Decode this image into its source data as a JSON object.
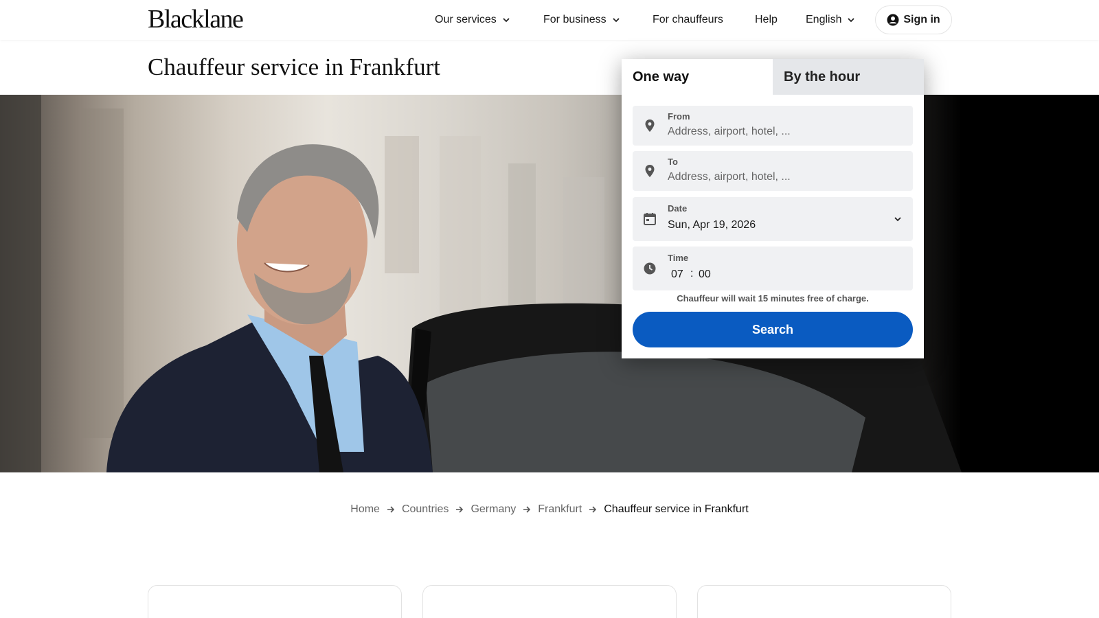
{
  "brand": {
    "logo_text": "Blacklane",
    "accent_color": "#0a5bc1"
  },
  "nav": {
    "items": [
      {
        "label": "Our services",
        "has_dropdown": true
      },
      {
        "label": "For business",
        "has_dropdown": true
      },
      {
        "label": "For chauffeurs",
        "has_dropdown": false
      },
      {
        "label": "Help",
        "has_dropdown": false
      },
      {
        "label": "English",
        "has_dropdown": true
      }
    ],
    "signin_label": "Sign in"
  },
  "page": {
    "title": "Chauffeur service in Frankfurt"
  },
  "booking": {
    "tabs": [
      {
        "label": "One way",
        "active": true
      },
      {
        "label": "By the hour",
        "active": false
      }
    ],
    "from": {
      "label": "From",
      "placeholder": "Address, airport, hotel, ..."
    },
    "to": {
      "label": "To",
      "placeholder": "Address, airport, hotel, ..."
    },
    "date": {
      "label": "Date",
      "value": "Sun, Apr 19, 2026"
    },
    "time": {
      "label": "Time",
      "hour": "07",
      "separator": ":",
      "minute": "00"
    },
    "wait_note": "Chauffeur will wait 15 minutes free of charge.",
    "search_label": "Search"
  },
  "breadcrumb": {
    "items": [
      "Home",
      "Countries",
      "Germany",
      "Frankfurt"
    ],
    "current": "Chauffeur service in Frankfurt"
  },
  "icons": {
    "from": "location-pin-icon",
    "to": "location-pin-icon",
    "date": "calendar-icon",
    "time": "clock-icon",
    "signin": "user-circle-icon"
  }
}
